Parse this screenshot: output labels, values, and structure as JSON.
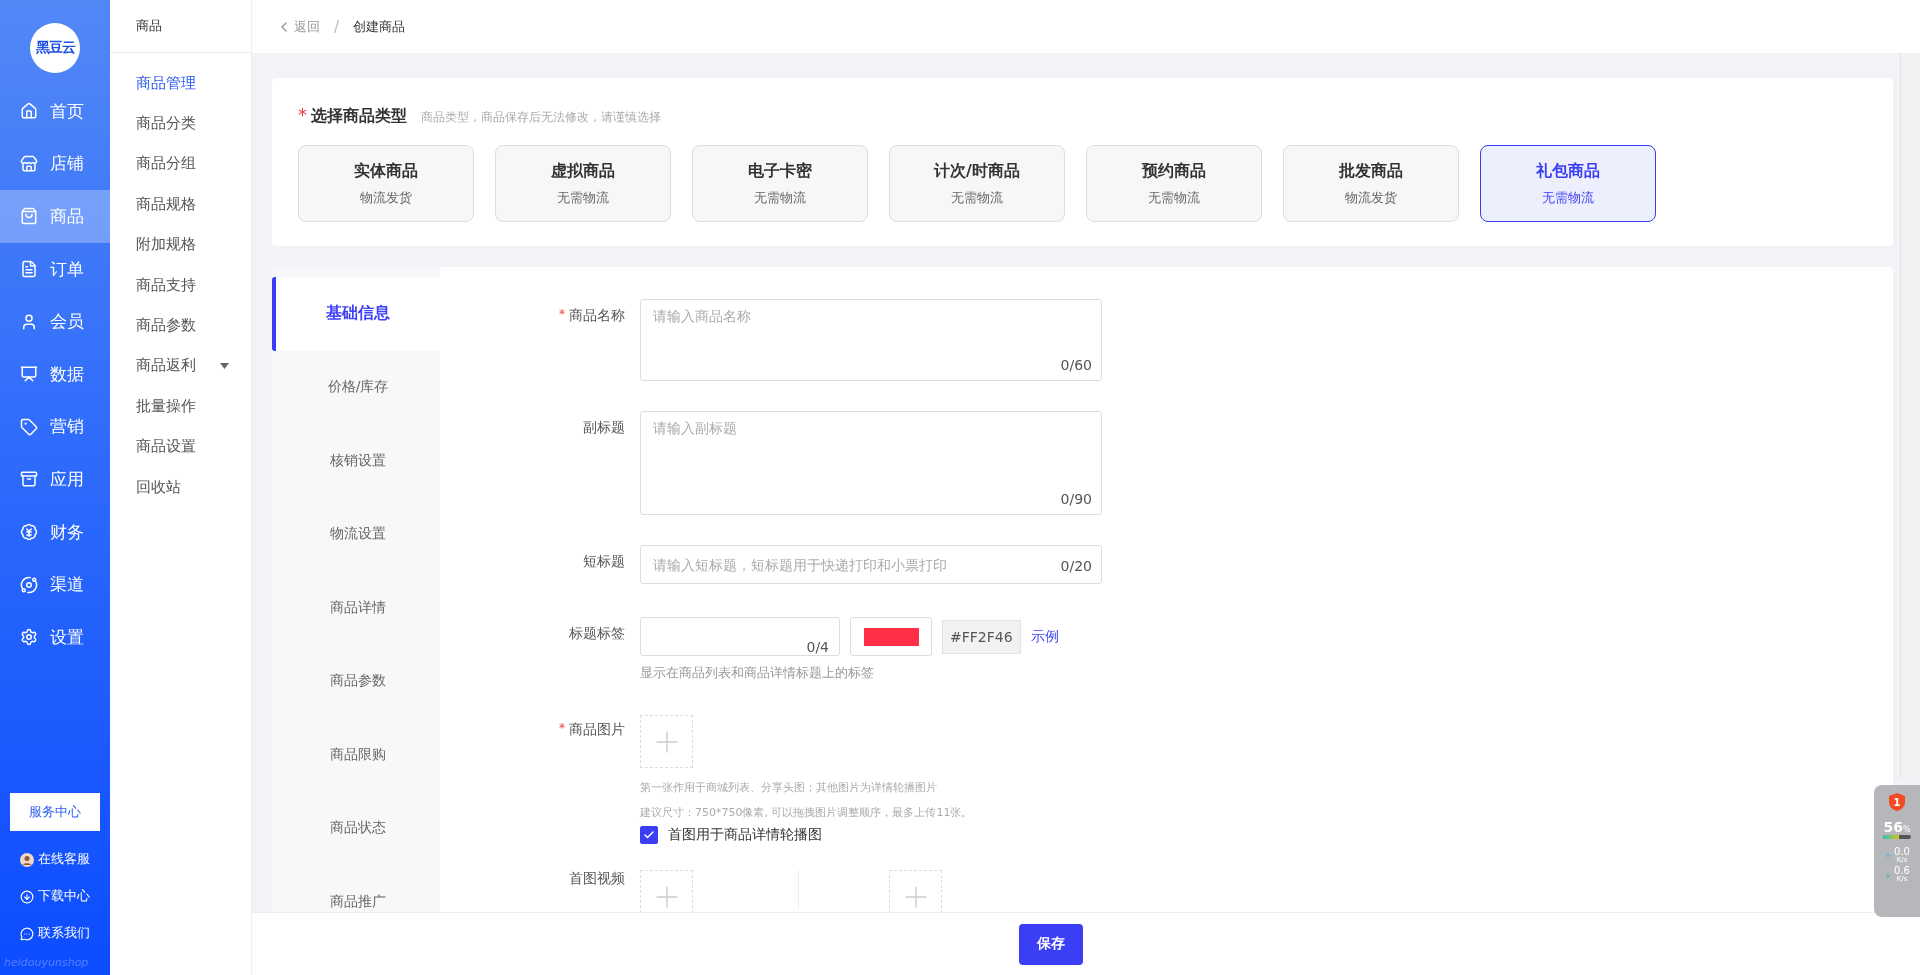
{
  "nav": {
    "logo": "黑豆云",
    "items": [
      {
        "label": "首页",
        "selected": false
      },
      {
        "label": "店铺",
        "selected": false
      },
      {
        "label": "商品",
        "selected": true
      },
      {
        "label": "订单",
        "selected": false
      },
      {
        "label": "会员",
        "selected": false
      },
      {
        "label": "数据",
        "selected": false
      },
      {
        "label": "营销",
        "selected": false
      },
      {
        "label": "应用",
        "selected": false
      },
      {
        "label": "财务",
        "selected": false
      },
      {
        "label": "渠道",
        "selected": false
      },
      {
        "label": "设置",
        "selected": false
      }
    ],
    "service_button": "服务中心",
    "links": [
      {
        "label": "在线客服"
      },
      {
        "label": "下载中心"
      },
      {
        "label": "联系我们"
      }
    ],
    "footer_brand": "heidouyunshop"
  },
  "subnav": {
    "title": "商品",
    "items": [
      {
        "label": "商品管理",
        "selected": true,
        "dropdown": false
      },
      {
        "label": "商品分类",
        "selected": false,
        "dropdown": false
      },
      {
        "label": "商品分组",
        "selected": false,
        "dropdown": false
      },
      {
        "label": "商品规格",
        "selected": false,
        "dropdown": false
      },
      {
        "label": "附加规格",
        "selected": false,
        "dropdown": false
      },
      {
        "label": "商品支持",
        "selected": false,
        "dropdown": false
      },
      {
        "label": "商品参数",
        "selected": false,
        "dropdown": false
      },
      {
        "label": "商品返利",
        "selected": false,
        "dropdown": true
      },
      {
        "label": "批量操作",
        "selected": false,
        "dropdown": false
      },
      {
        "label": "商品设置",
        "selected": false,
        "dropdown": false
      },
      {
        "label": "回收站",
        "selected": false,
        "dropdown": false
      }
    ]
  },
  "breadcrumb": {
    "back": "返回",
    "separator": "/",
    "current": "创建商品"
  },
  "type_section": {
    "required_mark": "*",
    "title": "选择商品类型",
    "hint": "商品类型，商品保存后无法修改，请谨慎选择",
    "types": [
      {
        "name": "实体商品",
        "sub": "物流发货",
        "selected": false
      },
      {
        "name": "虚拟商品",
        "sub": "无需物流",
        "selected": false
      },
      {
        "name": "电子卡密",
        "sub": "无需物流",
        "selected": false
      },
      {
        "name": "计次/时商品",
        "sub": "无需物流",
        "selected": false
      },
      {
        "name": "预约商品",
        "sub": "无需物流",
        "selected": false
      },
      {
        "name": "批发商品",
        "sub": "物流发货",
        "selected": false
      },
      {
        "name": "礼包商品",
        "sub": "无需物流",
        "selected": true
      }
    ]
  },
  "form_tabs": [
    {
      "label": "基础信息",
      "selected": true
    },
    {
      "label": "价格/库存",
      "selected": false
    },
    {
      "label": "核销设置",
      "selected": false
    },
    {
      "label": "物流设置",
      "selected": false
    },
    {
      "label": "商品详情",
      "selected": false
    },
    {
      "label": "商品参数",
      "selected": false
    },
    {
      "label": "商品限购",
      "selected": false
    },
    {
      "label": "商品状态",
      "selected": false
    },
    {
      "label": "商品推广",
      "selected": false
    }
  ],
  "form": [
    {
      "kind": "textarea",
      "label": "商品名称",
      "required": true,
      "placeholder": "请输入商品名称",
      "counter": "0/60"
    },
    {
      "kind": "textarea",
      "label": "副标题",
      "required": false,
      "placeholder": "请输入副标题",
      "counter": "0/90"
    },
    {
      "kind": "input",
      "label": "短标题",
      "required": false,
      "placeholder": "请输入短标题，短标题用于快递打印和小票打印",
      "counter": "0/20"
    },
    {
      "kind": "tag",
      "label": "标题标签",
      "required": false,
      "counter": "0/4",
      "color_code": "#FF2F46",
      "example_link": "示例",
      "help": "显示在商品列表和商品详情标题上的标签"
    },
    {
      "kind": "upload",
      "label": "商品图片",
      "required": true,
      "help": [
        "第一张作用于商城列表、分享头图；其他图片为详情轮播图片",
        "建议尺寸：750*750像素, 可以拖拽图片调整顺序，最多上传11张。"
      ],
      "checkbox": {
        "label": "首图用于商品详情轮播图",
        "checked": true
      }
    },
    {
      "kind": "video",
      "label": "首图视频",
      "required": false
    }
  ],
  "save_button": "保存",
  "overlay": {
    "badge": "1",
    "percent": "56",
    "percent_unit": "%",
    "level": 0.56,
    "upload": "0.0",
    "upload_unit": "K/s",
    "download": "0.6",
    "download_unit": "K/s"
  }
}
